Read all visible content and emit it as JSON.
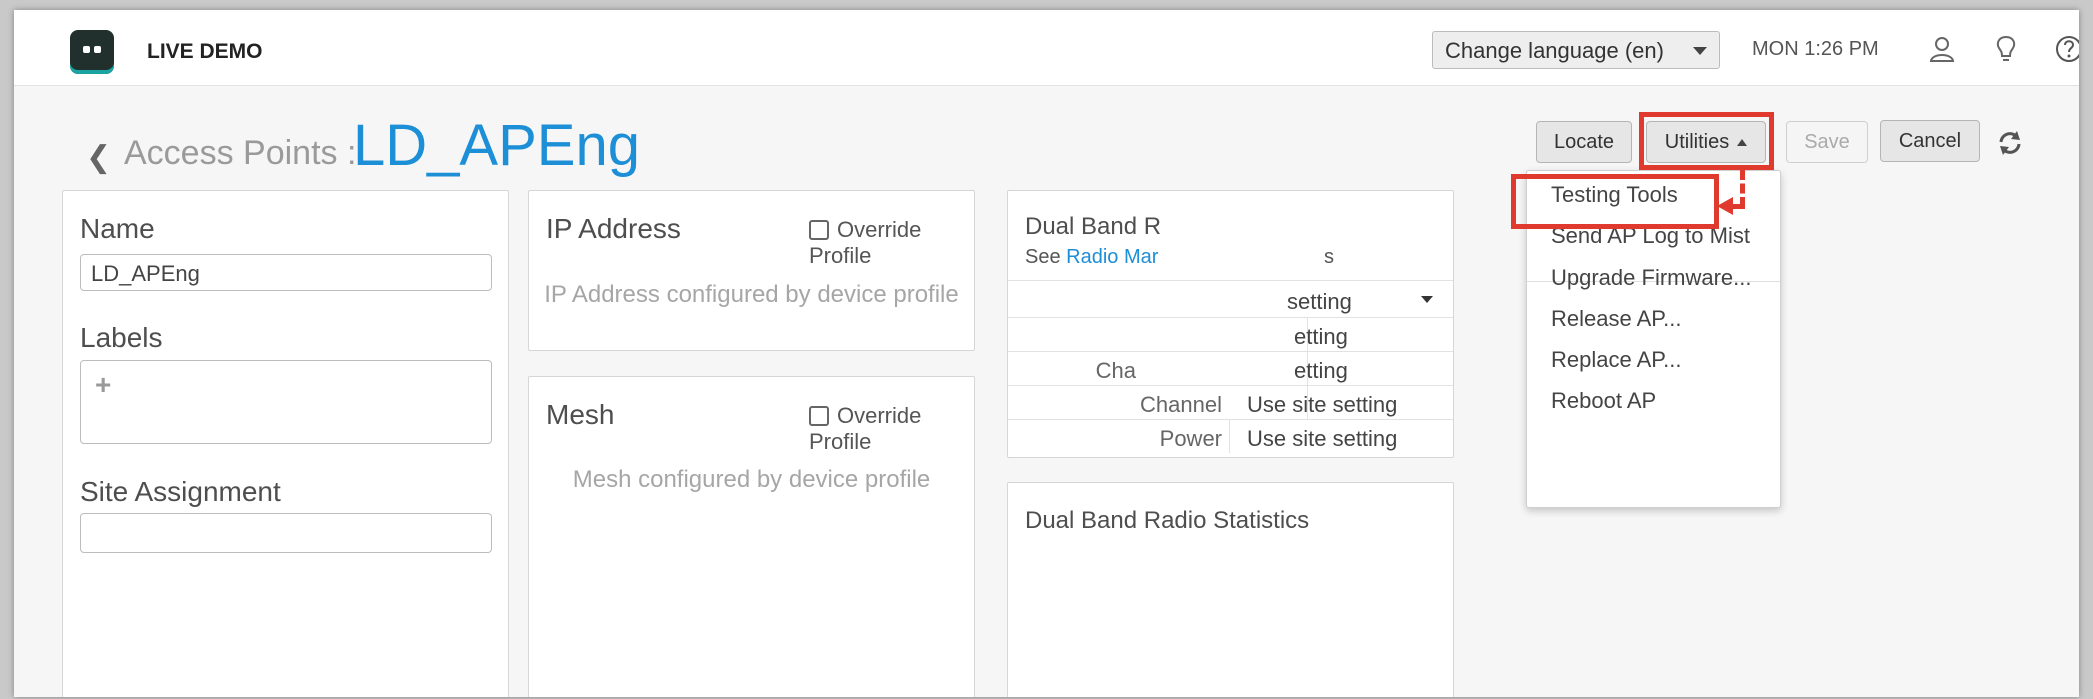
{
  "header": {
    "brand": "LIVE DEMO",
    "language_select": "Change language (en)",
    "clock": "MON 1:26 PM",
    "icons": [
      "user-icon",
      "lightbulb-icon",
      "help-icon"
    ]
  },
  "breadcrumb": {
    "parent": "Access Points :",
    "current": "LD_APEng"
  },
  "toolbar": {
    "locate": "Locate",
    "utilities": "Utilities",
    "save": "Save",
    "cancel": "Cancel"
  },
  "utilities_menu": {
    "items": [
      "Testing Tools",
      "Send AP Log to Mist",
      "Upgrade Firmware...",
      "Release AP...",
      "Replace AP...",
      "Reboot AP"
    ]
  },
  "name_card": {
    "name_label": "Name",
    "name_value": "LD_APEng",
    "labels_label": "Labels",
    "add_symbol": "+",
    "site_label": "Site Assignment"
  },
  "ip_card": {
    "title": "IP Address",
    "override": "Override Profile",
    "message": "IP Address configured by device profile"
  },
  "mesh_card": {
    "title": "Mesh",
    "override": "Override Profile",
    "message": "Mesh configured by device profile"
  },
  "radio_card": {
    "title_visible": "Dual Band R",
    "see_prefix": "See ",
    "link_visible": "Radio Mar",
    "trailing_visible": "s",
    "rows": [
      {
        "label": "",
        "value": "setting"
      },
      {
        "label": "",
        "value": "etting"
      },
      {
        "label": "Cha",
        "value": "etting"
      },
      {
        "label": "Channel",
        "value": "Use site setting"
      },
      {
        "label": "Power",
        "value": "Use site setting"
      }
    ]
  },
  "stats_card": {
    "title_visible": "Dual Band Radio Statistics"
  },
  "colors": {
    "accent": "#1c8fd6",
    "highlight": "#e03a2e"
  }
}
